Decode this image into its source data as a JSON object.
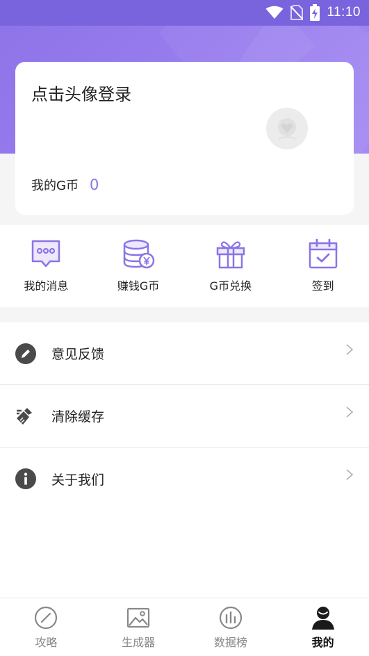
{
  "status_bar": {
    "time": "11:10"
  },
  "profile": {
    "login_prompt": "点击头像登录",
    "coin_label": "我的G币",
    "coin_value": "0"
  },
  "quick_menu": [
    {
      "label": "我的消息",
      "icon": "message-icon"
    },
    {
      "label": "赚钱G币",
      "icon": "coin-stack-icon"
    },
    {
      "label": "G币兑换",
      "icon": "gift-icon"
    },
    {
      "label": "签到",
      "icon": "calendar-check-icon"
    }
  ],
  "settings": [
    {
      "label": "意见反馈",
      "icon": "pencil-icon"
    },
    {
      "label": "清除缓存",
      "icon": "broom-icon"
    },
    {
      "label": "关于我们",
      "icon": "info-icon"
    }
  ],
  "tabbar": [
    {
      "label": "攻略",
      "icon": "compass-icon",
      "active": false
    },
    {
      "label": "生成器",
      "icon": "image-icon",
      "active": false
    },
    {
      "label": "数据榜",
      "icon": "bar-chart-icon",
      "active": false
    },
    {
      "label": "我的",
      "icon": "user-icon",
      "active": true
    }
  ],
  "colors": {
    "accent": "#8b74e6",
    "header": "#8d74e8",
    "status_bar": "#7a64de"
  }
}
